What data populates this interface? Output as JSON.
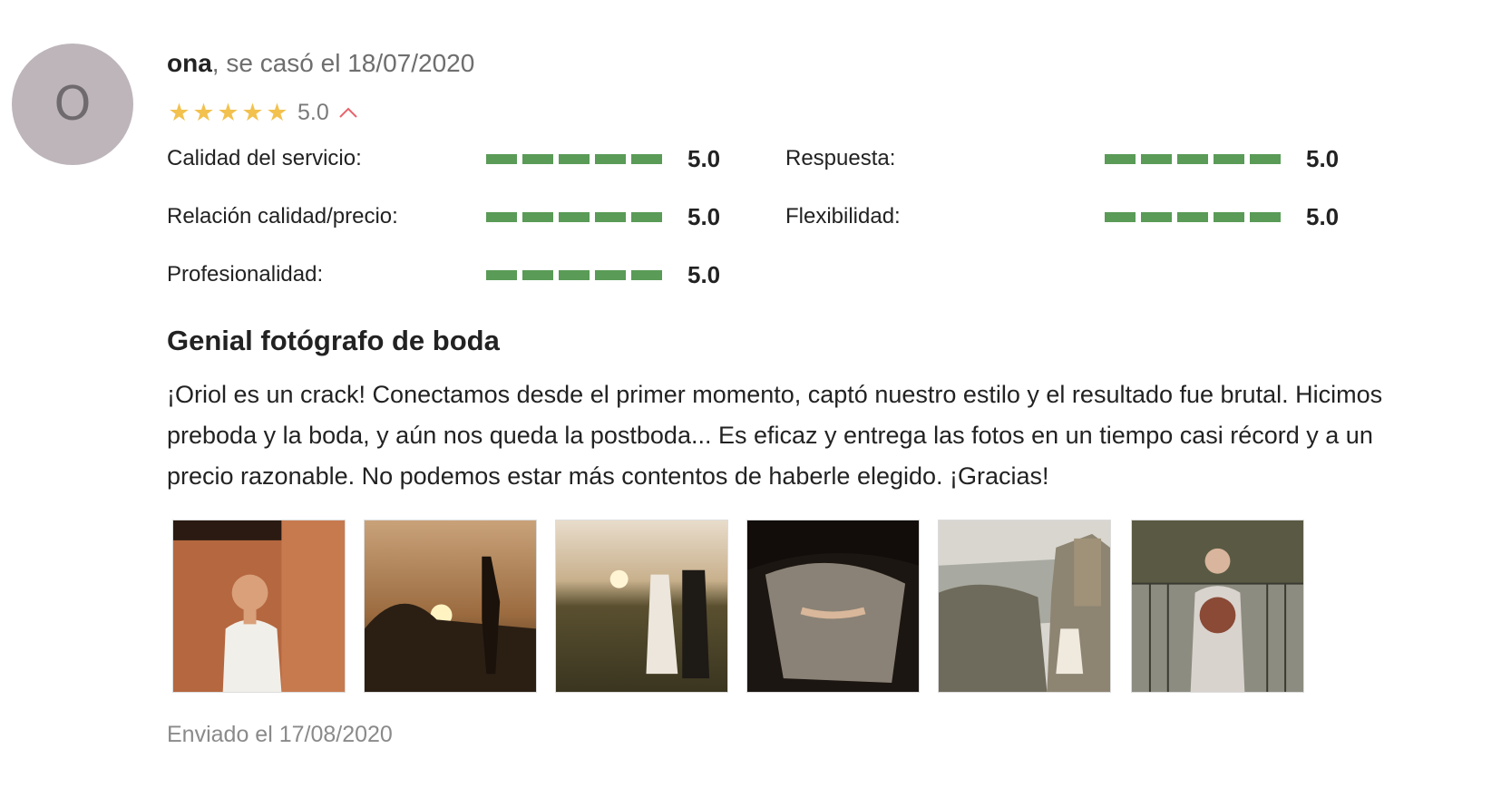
{
  "reviewer": {
    "initial": "O",
    "name": "ona",
    "married_text": ", se casó el 18/07/2020"
  },
  "rating": {
    "stars": 5,
    "value": "5.0"
  },
  "criteria": [
    {
      "label": "Calidad del servicio:",
      "value": "5.0",
      "score": 5
    },
    {
      "label": "Respuesta:",
      "value": "5.0",
      "score": 5
    },
    {
      "label": "Relación calidad/precio:",
      "value": "5.0",
      "score": 5
    },
    {
      "label": "Flexibilidad:",
      "value": "5.0",
      "score": 5
    },
    {
      "label": "Profesionalidad:",
      "value": "5.0",
      "score": 5
    }
  ],
  "review": {
    "title": "Genial fotógrafo de boda",
    "text": "¡Oriol es un crack! Conectamos desde el primer momento, captó nuestro estilo y el resultado fue brutal. Hicimos preboda y la boda, y aún nos queda la postboda... Es eficaz y entrega las fotos en un tiempo casi récord y a un precio razonable. No podemos estar más contentos de haberle elegido. ¡Gracias!"
  },
  "photos_count": 6,
  "sent": "Enviado el 17/08/2020",
  "colors": {
    "star": "#f2c14e",
    "bar": "#5a9b57",
    "chevron": "#e8626a",
    "avatar_bg": "#bdb5ba"
  }
}
